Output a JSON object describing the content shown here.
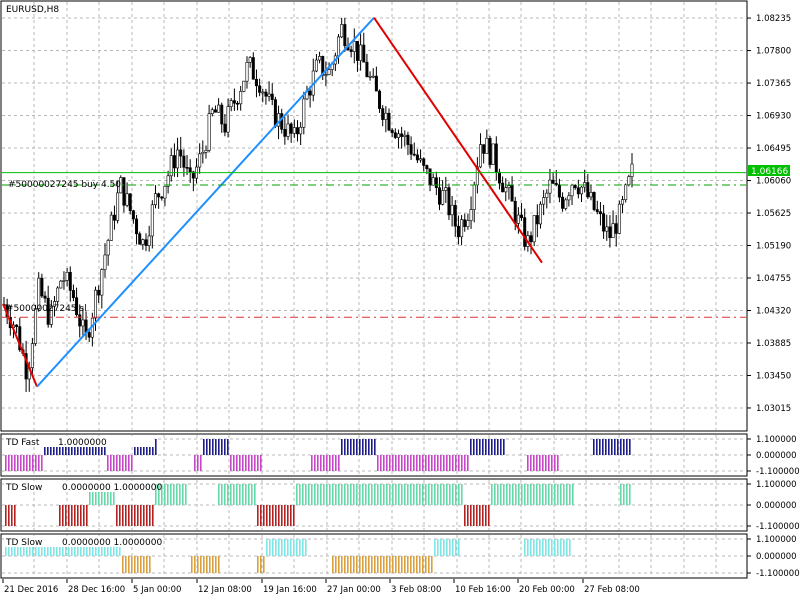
{
  "main": {
    "symbol_label": "EURUSD,H8",
    "order_buy_label": "#50000027245 buy 4.50",
    "order_sl_label": "#50000027245 sl",
    "current_price": "1.06166",
    "price_ticks": [
      "1.08235",
      "1.07800",
      "1.07365",
      "1.06930",
      "1.06495",
      "1.06060",
      "1.05625",
      "1.05190",
      "1.04755",
      "1.04320",
      "1.03885",
      "1.03450",
      "1.03015"
    ],
    "price_range": [
      1.0272,
      1.0845
    ],
    "buy_level": 1.06,
    "sl_level": 1.0423,
    "current_level": 1.06166
  },
  "indicators": [
    {
      "title": "TD Fast",
      "values": "1.0000000",
      "ticks": [
        "1.100000",
        "0.000000",
        "-1.100000"
      ],
      "up_color": "#1c1c8a",
      "down_color": "#c846c8"
    },
    {
      "title": "TD Slow",
      "values": "0.0000000 1.0000000",
      "ticks": [
        "1.100000",
        "0.000000",
        "-1.100000"
      ],
      "up_color": "#66d9a8",
      "down_color": "#b22222"
    },
    {
      "title": "TD Slow",
      "values": "0.0000000 1.0000000",
      "ticks": [
        "1.100000",
        "0.000000",
        "-1.100000"
      ],
      "up_color": "#7ee6e6",
      "down_color": "#d9a040"
    }
  ],
  "time_axis": [
    "21 Dec 2016",
    "28 Dec 16:00",
    "5 Jan 00:00",
    "12 Jan 08:00",
    "19 Jan 16:00",
    "27 Jan 00:00",
    "3 Feb 08:00",
    "10 Feb 16:00",
    "20 Feb 00:00",
    "27 Feb 08:00"
  ],
  "chart_data": {
    "type": "candlestick",
    "title": "EURUSD,H8",
    "ylim": [
      1.0272,
      1.0845
    ],
    "x": [
      "21 Dec 2016",
      "28 Dec 16:00",
      "5 Jan 00:00",
      "12 Jan 08:00",
      "19 Jan 16:00",
      "27 Jan 00:00",
      "3 Feb 08:00",
      "10 Feb 16:00",
      "20 Feb 00:00",
      "27 Feb 08:00"
    ],
    "close_path": [
      1.044,
      1.041,
      1.035,
      1.046,
      1.042,
      1.048,
      1.045,
      1.039,
      1.046,
      1.053,
      1.06,
      1.056,
      1.052,
      1.058,
      1.061,
      1.065,
      1.06,
      1.064,
      1.07,
      1.068,
      1.072,
      1.076,
      1.074,
      1.07,
      1.068,
      1.066,
      1.072,
      1.076,
      1.075,
      1.081,
      1.079,
      1.076,
      1.072,
      1.069,
      1.067,
      1.065,
      1.062,
      1.06,
      1.058,
      1.054,
      1.057,
      1.066,
      1.064,
      1.06,
      1.056,
      1.052,
      1.056,
      1.06,
      1.058,
      1.061,
      1.059,
      1.056,
      1.053,
      1.056,
      1.0616
    ],
    "zigzag": [
      {
        "color": "#e00000",
        "points": [
          [
            1.0441
          ],
          [
            1.033
          ]
        ]
      },
      {
        "color": "#1e90ff",
        "points": [
          [
            1.033
          ],
          [
            1.0824
          ]
        ]
      },
      {
        "color": "#e00000",
        "points": [
          [
            1.0824
          ],
          [
            1.0496
          ]
        ]
      }
    ]
  },
  "colors": {
    "grid": "#b8b8b8",
    "current_line": "#00c000",
    "buy_line": "#00a000",
    "sl_line": "#e03030",
    "zigzag_up": "#1e90ff",
    "zigzag_down": "#e00000"
  }
}
